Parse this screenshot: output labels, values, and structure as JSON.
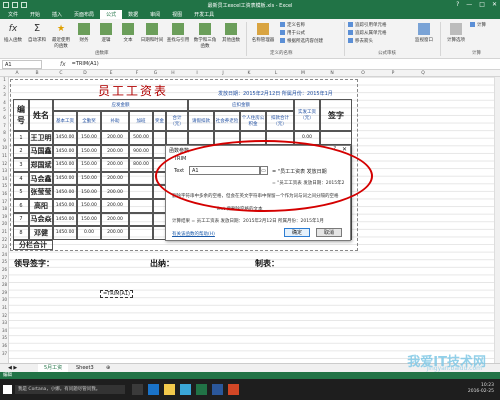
{
  "titlebar": {
    "title": "最新员工excel工资表模板.xls - Excel",
    "controls": [
      "?",
      "—",
      "□",
      "✕"
    ]
  },
  "ribbon_tabs": [
    "文件",
    "开始",
    "插入",
    "页面布局",
    "公式",
    "数据",
    "审阅",
    "视图",
    "开发工具"
  ],
  "active_tab": "公式",
  "ribbon": {
    "insert_function": "插入函数",
    "autosum": "自动求和",
    "recent": "最近使用的函数",
    "financial": "财务",
    "logical": "逻辑",
    "text": "文本",
    "datetime": "日期和时间",
    "lookup": "查找与引用",
    "math": "数学和三角函数",
    "other": "其他函数",
    "name_manager": "名称管理器",
    "define_name": "定义名称",
    "use_in_formula": "用于公式",
    "create_from_sel": "根据所选内容创建",
    "trace_precedents": "追踪引用单元格",
    "trace_dependents": "追踪从属单元格",
    "remove_arrows": "移去箭头",
    "watch": "监视窗口",
    "calc_options": "计算选项",
    "calculate": "计算",
    "group_function_library": "函数库",
    "group_defined_names": "定义的名称",
    "group_auditing": "公式审核",
    "group_calculation": "计算"
  },
  "formula_bar": {
    "name_box": "A1",
    "fx": "fx",
    "formula": "=TRIM(A1)"
  },
  "columns": [
    "A",
    "B",
    "C",
    "D",
    "E",
    "F",
    "G",
    "H",
    "I",
    "J",
    "K",
    "L",
    "M",
    "N",
    "O",
    "P",
    "Q"
  ],
  "rows": [
    "1",
    "2",
    "3",
    "4",
    "5",
    "6",
    "7",
    "8",
    "9",
    "10",
    "11",
    "12",
    "13",
    "14",
    "15",
    "16",
    "17",
    "18",
    "19",
    "20",
    "21",
    "22",
    "23",
    "24",
    "25",
    "26",
    "27",
    "28",
    "29",
    "30",
    "31",
    "32",
    "33",
    "34",
    "35",
    "36",
    "37"
  ],
  "sheet": {
    "title": "员工工资表",
    "company_line": "发放日期：2015年2月12日  所属月份：2015年1月",
    "headers": {
      "seq": "编号",
      "name": "姓名",
      "payable": "应发金额",
      "deduct": "应扣金额",
      "actual": "实发工资（元）",
      "sign": "签字",
      "base": "基本工资",
      "allowance": "全勤奖",
      "bonus": "补助",
      "ot": "加班",
      "subtotal": "奖金",
      "total": "合计（元）",
      "leave": "请假扣款",
      "social": "社会养老险",
      "housing": "个人住房公积金",
      "deduct_total": "扣款合计（元）"
    },
    "rows": [
      {
        "no": "1",
        "name": "王卫明",
        "base": "1450.00",
        "att": "150.00",
        "sub": "200.00",
        "ot": "500.00",
        "bonus": "",
        "total": ""
      },
      {
        "no": "2",
        "name": "马国鑫",
        "base": "1450.00",
        "att": "150.00",
        "sub": "200.00",
        "ot": "900.00",
        "bonus": "",
        "total": ""
      },
      {
        "no": "3",
        "name": "郑国斌",
        "base": "1450.00",
        "att": "150.00",
        "sub": "200.00",
        "ot": "800.00",
        "bonus": "",
        "total": ""
      },
      {
        "no": "4",
        "name": "马会鑫",
        "base": "1450.00",
        "att": "150.00",
        "sub": "200.00",
        "ot": "",
        "bonus": "",
        "total": ""
      },
      {
        "no": "5",
        "name": "张莹莹",
        "base": "1450.00",
        "att": "150.00",
        "sub": "200.00",
        "ot": "",
        "bonus": "",
        "total": ""
      },
      {
        "no": "6",
        "name": "高阳",
        "base": "1450.00",
        "att": "150.00",
        "sub": "200.00",
        "ot": "",
        "bonus": "",
        "total": ""
      },
      {
        "no": "7",
        "name": "马会焱",
        "base": "1450.00",
        "att": "150.00",
        "sub": "200.00",
        "ot": "",
        "bonus": "",
        "total": ""
      },
      {
        "no": "8",
        "name": "邓健",
        "base": "1450.00",
        "att": "0.00",
        "sub": "200.00",
        "ot": "",
        "bonus": "",
        "total": ""
      }
    ],
    "row1_actual": "0.00",
    "subtotal_label": "分栏合计",
    "leader_sign": "领导签字：",
    "cashier": "出纳：",
    "preparer": "制表："
  },
  "active_cell_text": "=TRIM(A1)",
  "dialog": {
    "title": "函数参数",
    "help": "?",
    "close": "✕",
    "function": "TRIM",
    "arg_label": "Text",
    "arg_value": "A1",
    "arg_result": "= \"员工工资表  发放日期",
    "result_line": "= \"员工工资表  发放日期：2015年2",
    "desc1": "删除字符串中多余的空格，但会在英文字符串中保留一个作为词与词之间分隔的空格",
    "desc2": "Text  要删除空格的文本",
    "calc_result": "计算结果 =   员工工资表  发放日期：2015年2月12日  所属月份：2015年1月",
    "help_link": "有关该函数的帮助(H)",
    "ok": "确定",
    "cancel": "取消"
  },
  "sheet_tabs": [
    "5月工资",
    "Sheet3"
  ],
  "status": "编辑",
  "taskbar": {
    "search": "我是 Cortana，小娜。有问题尽管问我。",
    "time": "10:23",
    "date": "2016-02-25"
  },
  "watermark": {
    "logo": "我爱IT技术网",
    "url": "jingyan.baidu.com"
  }
}
